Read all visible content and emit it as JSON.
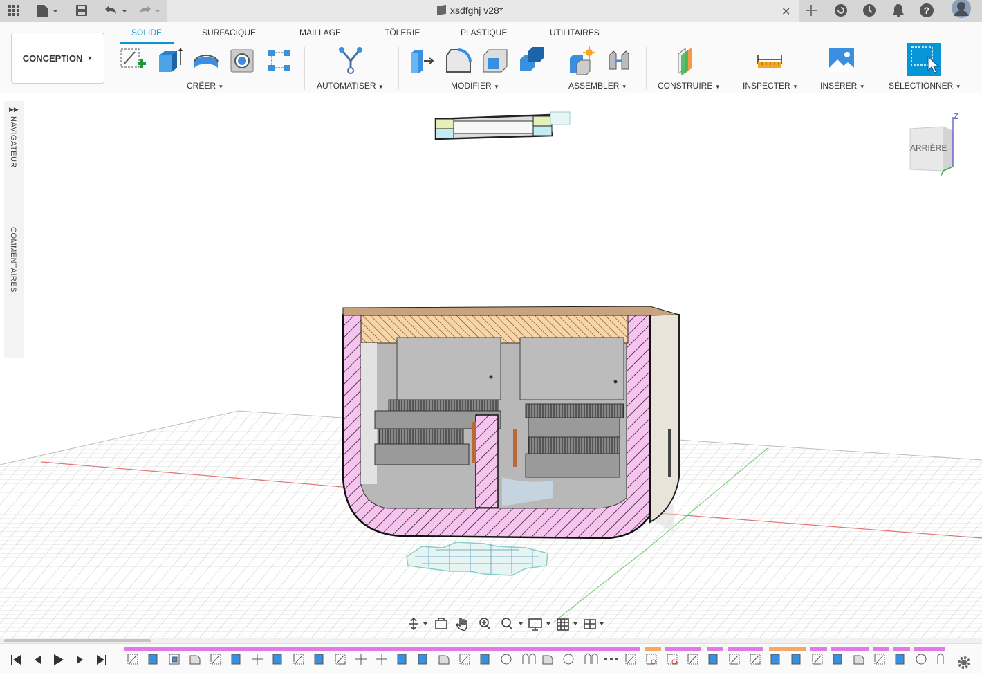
{
  "title_bar": {
    "document_title": "xsdfghj v28*",
    "close_label": "✕",
    "icons": [
      "apps-grid-icon",
      "file-menu-icon",
      "save-icon",
      "undo-icon",
      "redo-icon",
      "document-cube-icon",
      "new-tab-icon",
      "extensions-icon",
      "job-status-icon",
      "notifications-icon",
      "help-icon",
      "user-avatar"
    ]
  },
  "workspace": {
    "label": "CONCEPTION"
  },
  "tabs": [
    "SOLIDE",
    "SURFACIQUE",
    "MAILLAGE",
    "TÔLERIE",
    "PLASTIQUE",
    "UTILITAIRES"
  ],
  "active_tab": "SOLIDE",
  "groups": {
    "create": "CRÉER",
    "automate": "AUTOMATISER",
    "modify": "MODIFIER",
    "assemble": "ASSEMBLER",
    "construct": "CONSTRUIRE",
    "inspect": "INSPECTER",
    "insert": "INSÉRER",
    "select": "SÉLECTIONNER"
  },
  "side_panel": {
    "navigator": "NAVIGATEUR",
    "comments": "COMMENTAIRES"
  },
  "viewcube": {
    "face_label": "ARRIÈRE",
    "axis_label": "Z"
  },
  "colors": {
    "accent": "#0696d7",
    "section_pink": "#f4c2ec",
    "section_orange": "#f4d3a6",
    "timeline_pink": "#e27ae6"
  }
}
